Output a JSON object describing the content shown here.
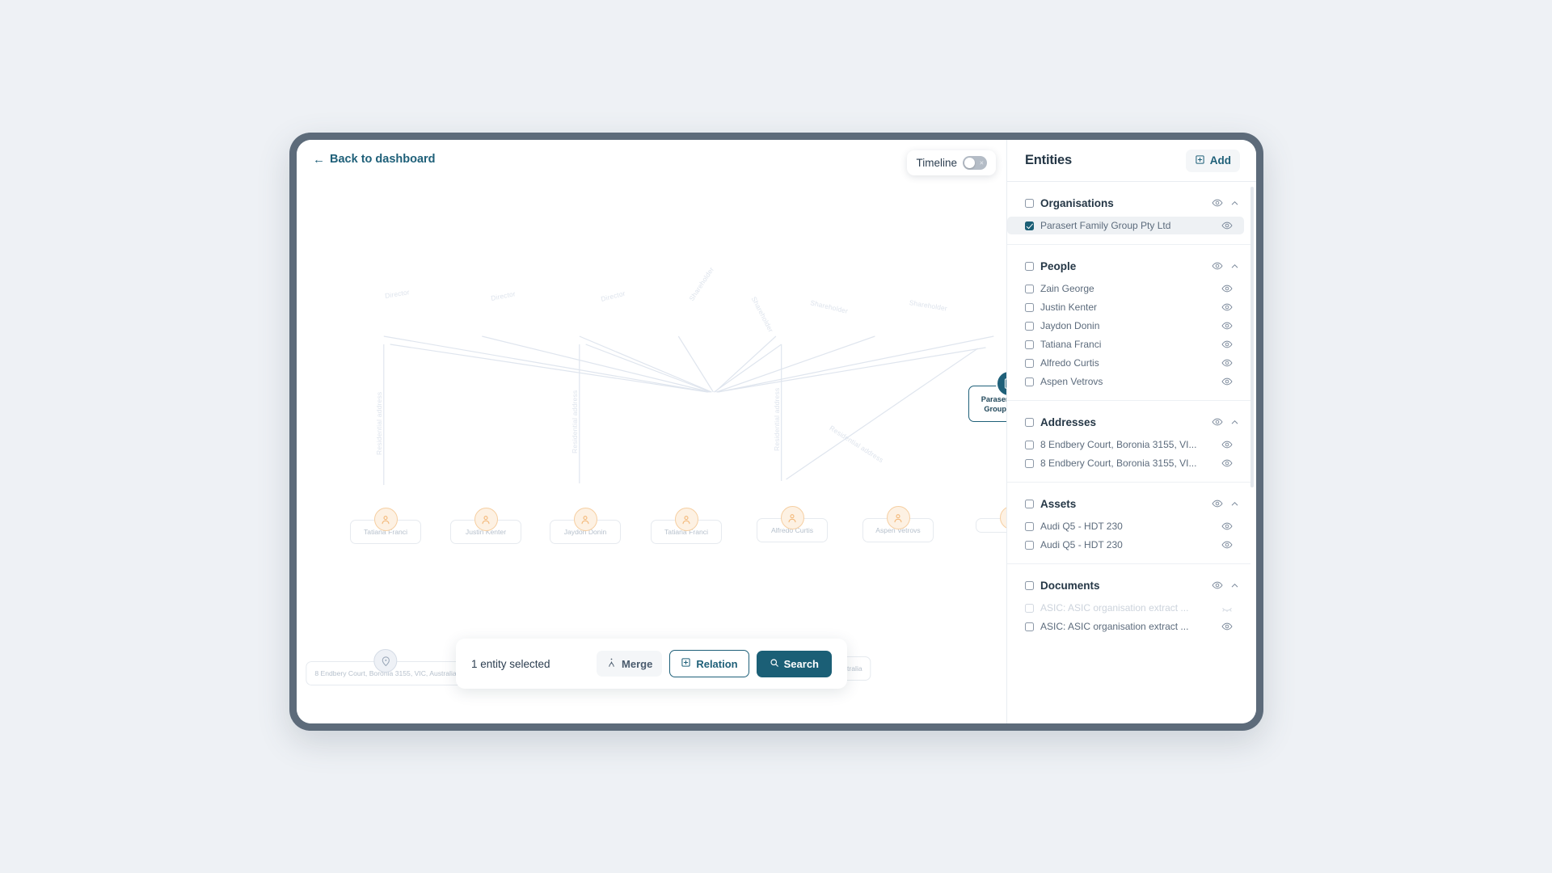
{
  "window": {
    "back_link": "Back to dashboard",
    "back_arrow_icon": "arrow-left-icon"
  },
  "timeline": {
    "label": "Timeline",
    "enabled": false,
    "off_mark": "×"
  },
  "graph": {
    "root": {
      "label": "Parasert Family Group Pty Ltd",
      "icon": "building-icon",
      "type": "organisation"
    },
    "people": [
      {
        "label": "Tatiana Franci",
        "icon": "person-icon"
      },
      {
        "label": "Justin Kenter",
        "icon": "person-icon"
      },
      {
        "label": "Jaydon Donin",
        "icon": "person-icon"
      },
      {
        "label": "Tatiana Franci",
        "icon": "person-icon"
      },
      {
        "label": "Alfredo Curtis",
        "icon": "person-icon"
      },
      {
        "label": "Aspen Vetrovs",
        "icon": "person-icon"
      },
      {
        "label": "",
        "icon": "person-icon"
      }
    ],
    "addresses": [
      {
        "label": "8 Endbery Court, Boronia 3155, VIC, Australia",
        "icon": "map-pin-icon"
      },
      {
        "label": "8 Endbery Court, Boronia 3155, VIC, Australia",
        "icon": "map-pin-icon"
      },
      {
        "label": "8 Endbery Court, Boronia 3155, VIC, Australia",
        "icon": "map-pin-icon"
      }
    ],
    "edge_labels": {
      "director": "Director",
      "shareholder": "Shareholder",
      "residential": "Residential address"
    }
  },
  "action_bar": {
    "selection_text": "1 entity selected",
    "merge_label": "Merge",
    "merge_icon": "merge-icon",
    "relation_label": "Relation",
    "relation_icon": "plus-box-icon",
    "search_label": "Search",
    "search_icon": "search-icon"
  },
  "entities": {
    "title": "Entities",
    "add_label": "Add",
    "add_icon": "plus-box-icon",
    "groups": [
      {
        "title": "Organisations",
        "checked": false,
        "items": [
          {
            "label": "Parasert Family Group Pty Ltd",
            "checked": true,
            "selected": true,
            "hidden": false
          }
        ]
      },
      {
        "title": "People",
        "checked": false,
        "items": [
          {
            "label": "Zain George",
            "checked": false,
            "selected": false,
            "hidden": false
          },
          {
            "label": "Justin Kenter",
            "checked": false,
            "selected": false,
            "hidden": false
          },
          {
            "label": "Jaydon Donin",
            "checked": false,
            "selected": false,
            "hidden": false
          },
          {
            "label": "Tatiana Franci",
            "checked": false,
            "selected": false,
            "hidden": false
          },
          {
            "label": "Alfredo Curtis",
            "checked": false,
            "selected": false,
            "hidden": false
          },
          {
            "label": "Aspen Vetrovs",
            "checked": false,
            "selected": false,
            "hidden": false
          }
        ]
      },
      {
        "title": "Addresses",
        "checked": false,
        "items": [
          {
            "label": "8 Endbery Court, Boronia 3155, VI...",
            "checked": false,
            "selected": false,
            "hidden": false
          },
          {
            "label": "8 Endbery Court, Boronia 3155, VI...",
            "checked": false,
            "selected": false,
            "hidden": false
          }
        ]
      },
      {
        "title": "Assets",
        "checked": false,
        "items": [
          {
            "label": "Audi Q5 - HDT 230",
            "checked": false,
            "selected": false,
            "hidden": false
          },
          {
            "label": "Audi Q5 - HDT 230",
            "checked": false,
            "selected": false,
            "hidden": false
          }
        ]
      },
      {
        "title": "Documents",
        "checked": false,
        "items": [
          {
            "label": "ASIC: ASIC organisation extract ...",
            "checked": false,
            "selected": false,
            "hidden": true
          },
          {
            "label": "ASIC: ASIC organisation extract ...",
            "checked": false,
            "selected": false,
            "hidden": false
          }
        ]
      }
    ]
  },
  "colors": {
    "accent": "#1b5f76",
    "frame": "#5d6b7a",
    "page_bg": "#eef1f5",
    "person_node": "#f6cfa2",
    "address_node": "#d5dce6",
    "edge": "#dfe5ee"
  }
}
